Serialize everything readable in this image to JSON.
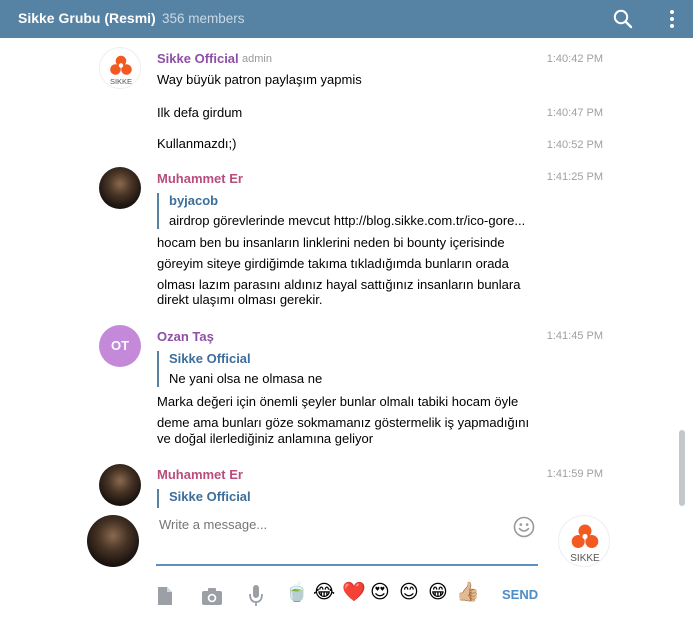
{
  "header": {
    "title": "Sikke Grubu (Resmi)",
    "members": "356 members"
  },
  "logo_text": "SIKKE",
  "messages": [
    {
      "author": "Sikke Official",
      "role": "admin",
      "text": "Way büyük patron paylaşım yapmis",
      "time": "1:40:42 PM"
    },
    {
      "text": "Ilk defa girdum",
      "time": "1:40:47 PM"
    },
    {
      "text": "Kullanmazdı;)",
      "time": "1:40:52 PM"
    },
    {
      "author": "Muhammet Er",
      "time": "1:41:25 PM",
      "reply": {
        "name": "byjacob",
        "text": "airdrop görevlerinde mevcut http://blog.sikke.com.tr/ico-gore..."
      },
      "lines": [
        "hocam ben bu insanların linklerini neden bi bounty içerisinde",
        "göreyim siteye girdiğimde takıma tıkladığımda bunların orada",
        "olması lazım parasını aldınız hayal sattığınız insanların bunlara",
        "direkt ulaşımı olması gerekir."
      ]
    },
    {
      "author": "Ozan Taş",
      "initials": "OT",
      "time": "1:41:45 PM",
      "reply": {
        "name": "Sikke Official",
        "text": "Ne yani olsa ne olmasa ne"
      },
      "lines": [
        "Marka değeri için önemli şeyler bunlar olmalı tabiki hocam öyle",
        "deme ama bunları göze sokmamanız göstermelik iş yapmadığını",
        "ve doğal ilerlediğiniz anlamına geliyor"
      ]
    },
    {
      "author": "Muhammet Er",
      "time": "1:41:59 PM",
      "reply": {
        "name": "Sikke Official"
      }
    }
  ],
  "composer": {
    "placeholder": "Write a message...",
    "send_label": "SEND",
    "emojis": [
      "🍵",
      "😂",
      "❤️",
      "😍",
      "😊",
      "😁",
      "👍🏼"
    ]
  },
  "colors": {
    "header_bg": "#5682a3",
    "accent": "#4c8dc6",
    "logo_orange": "#f25a22"
  }
}
